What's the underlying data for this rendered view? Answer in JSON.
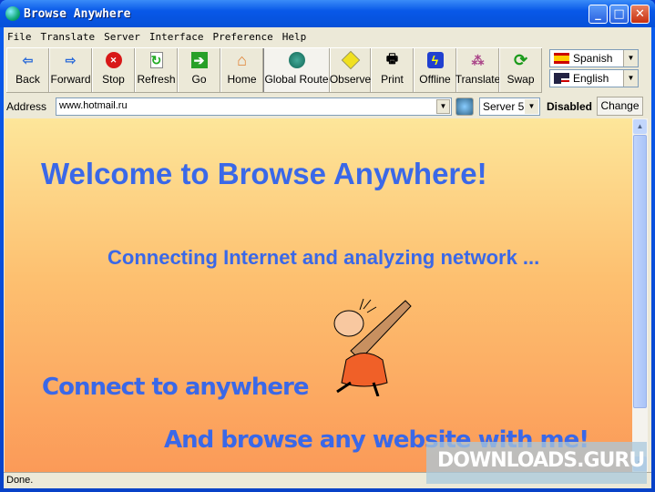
{
  "window": {
    "title": "Browse Anywhere"
  },
  "menu": [
    "File",
    "Translate",
    "Server",
    "Interface",
    "Preference",
    "Help"
  ],
  "toolbar": [
    {
      "label": "Back",
      "icon": "back-arrow-icon"
    },
    {
      "label": "Forward",
      "icon": "forward-arrow-icon"
    },
    {
      "label": "Stop",
      "icon": "stop-icon"
    },
    {
      "label": "Refresh",
      "icon": "refresh-icon"
    },
    {
      "label": "Go",
      "icon": "go-icon"
    },
    {
      "label": "Home",
      "icon": "home-icon"
    },
    {
      "label": "Global Route",
      "icon": "globe-icon"
    },
    {
      "label": "Observe",
      "icon": "observe-icon"
    },
    {
      "label": "Print",
      "icon": "printer-icon"
    },
    {
      "label": "Offline",
      "icon": "lightning-icon"
    },
    {
      "label": "Translate",
      "icon": "translate-icon"
    },
    {
      "label": "Swap",
      "icon": "swap-icon"
    }
  ],
  "languages": {
    "from": "Spanish",
    "to": "English"
  },
  "address": {
    "label": "Address",
    "value": "www.hotmail.ru",
    "server": "Server 5",
    "status": "Disabled",
    "change": "Change"
  },
  "content": {
    "heading": "Welcome to Browse Anywhere!",
    "connecting": "Connecting Internet and analyzing network ...",
    "line1": "Connect to anywhere",
    "line2": "And browse any website with me!"
  },
  "statusbar": "Done.",
  "watermark": "DOWNLOADS.GURU"
}
